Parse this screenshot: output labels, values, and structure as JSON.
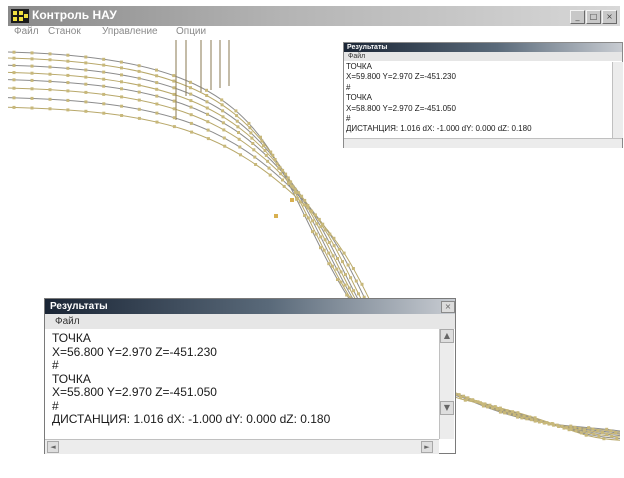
{
  "window": {
    "title": "Контроль НАУ",
    "icon": "dic-logo-icon",
    "controls": [
      "minimize-icon",
      "maximize-icon",
      "close-icon"
    ]
  },
  "menu": [
    "Файл",
    "Станок",
    "Управление",
    "Опции"
  ],
  "results_small": {
    "title": "Результаты",
    "menu_file": "Файл",
    "lines": [
      "ТОЧКА",
      "X=59.800  Y=2.970  Z=-451.230",
      "#",
      "ТОЧКА",
      "X=58.800  Y=2.970  Z=-451.050",
      "#",
      "ДИСТАНЦИЯ: 1.016  dX: -1.000  dY: 0.000  dZ: 0.180"
    ]
  },
  "results_large": {
    "title": "Результаты",
    "menu_file": "Файл",
    "lines": [
      "ТОЧКА",
      "X=56.800  Y=2.970  Z=-451.230",
      "#",
      "ТОЧКА",
      "X=55.800  Y=2.970  Z=-451.050",
      "#",
      "ДИСТАНЦИЯ: 1.016   dX: -1.000   dY: 0.000   dZ: 0.180"
    ]
  },
  "colors": {
    "path_gray": "#8c8c8c",
    "path_tan": "#b8a86a",
    "point_marker": "#c8b87a",
    "title_dark": "#1a2535"
  }
}
